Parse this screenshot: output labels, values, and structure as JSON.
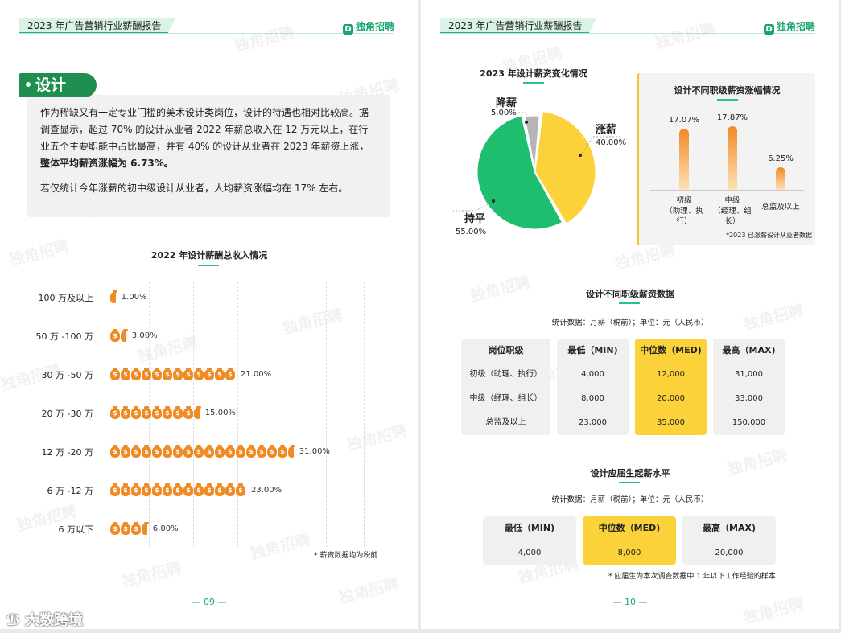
{
  "header_title": "2023 年广告营销行业薪酬报告",
  "brand": "独角招聘",
  "page9": {
    "section_title": "设计",
    "intro_p1_a": "作为稀缺又有一定专业门槛的美术设计类岗位，设计的待遇也相对比较高。据调查显示，超过 70% 的设计从业者 2022 年薪总收入在 12 万元以上，在行业五个主要职能中占比最高，并有 40% 的设计从业者在 2023 年薪资上涨，",
    "intro_p1_b": "整体平均薪资涨幅为 6.73%。",
    "intro_p2": "若仅统计今年涨薪的初中级设计从业者，人均薪资涨幅均在 17% 左右。",
    "chart_title": "2022 年设计薪酬总收入情况",
    "note": "* 薪资数据均为税前",
    "page_number": "09"
  },
  "chart_data": [
    {
      "type": "bar",
      "title": "2022 年设计薪酬总收入情况",
      "categories": [
        "100 万及以上",
        "50 万 -100 万",
        "30 万 -50 万",
        "20 万 -30 万",
        "12 万 -20 万",
        "6 万 -12 万",
        "6 万以下"
      ],
      "values": [
        1.0,
        3.0,
        21.0,
        15.0,
        31.0,
        23.0,
        6.0
      ],
      "labels": [
        "1.00%",
        "3.00%",
        "21.00%",
        "15.00%",
        "31.00%",
        "23.00%",
        "6.00%"
      ],
      "unit": "%"
    },
    {
      "type": "pie",
      "title": "2023 年设计薪资变化情况",
      "categories": [
        "降薪",
        "涨薪",
        "持平"
      ],
      "values": [
        5.0,
        40.0,
        55.0
      ],
      "labels": [
        "5.00%",
        "40.00%",
        "55.00%"
      ],
      "colors": [
        "#b5b5b5",
        "#fbd23a",
        "#1fbd6e"
      ]
    },
    {
      "type": "bar",
      "title": "设计不同职级薪资涨幅情况",
      "categories": [
        "初级\n（助理、执行）",
        "中级\n（经理、组长）",
        "总监及以上"
      ],
      "values": [
        17.07,
        17.87,
        6.25
      ],
      "labels": [
        "17.07%",
        "17.87%",
        "6.25%"
      ],
      "note": "*2023 已涨薪设计从业者数据"
    }
  ],
  "page10": {
    "pie_title": "2023 年设计薪资变化情况",
    "bar_title": "设计不同职级薪资涨幅情况",
    "bar_note": "*2023 已涨薪设计从业者数据",
    "bar_cats": [
      "初级",
      "（助理、执行）",
      "中级",
      "（经理、组长）",
      "总监及以上"
    ],
    "table1": {
      "title": "设计不同职级薪资数据",
      "subtitle": "统计数据：月薪（税前）；单位：元（人民币）",
      "headers": [
        "岗位职级",
        "最低（MIN)",
        "中位数（MED)",
        "最高（MAX)"
      ],
      "rows": [
        [
          "初级（助理、执行）",
          "4,000",
          "12,000",
          "31,000"
        ],
        [
          "中级（经理、组长）",
          "8,000",
          "20,000",
          "33,000"
        ],
        [
          "总监及以上",
          "23,000",
          "35,000",
          "150,000"
        ]
      ]
    },
    "table2": {
      "title": "设计应届生起薪水平",
      "subtitle": "统计数据：月薪（税前）；单位：元（人民币）",
      "headers": [
        "最低（MIN)",
        "中位数（MED)",
        "最高（MAX)"
      ],
      "values": [
        "4,000",
        "8,000",
        "20,000"
      ],
      "note": "* 应届生为本次调查数据中 1 年以下工作经验的样本"
    },
    "page_number": "10"
  },
  "footer_watermark": "大数跨境",
  "colors": {
    "accent": "#19a66e",
    "bag": "#f08a24",
    "highlight": "#fbd23a"
  }
}
